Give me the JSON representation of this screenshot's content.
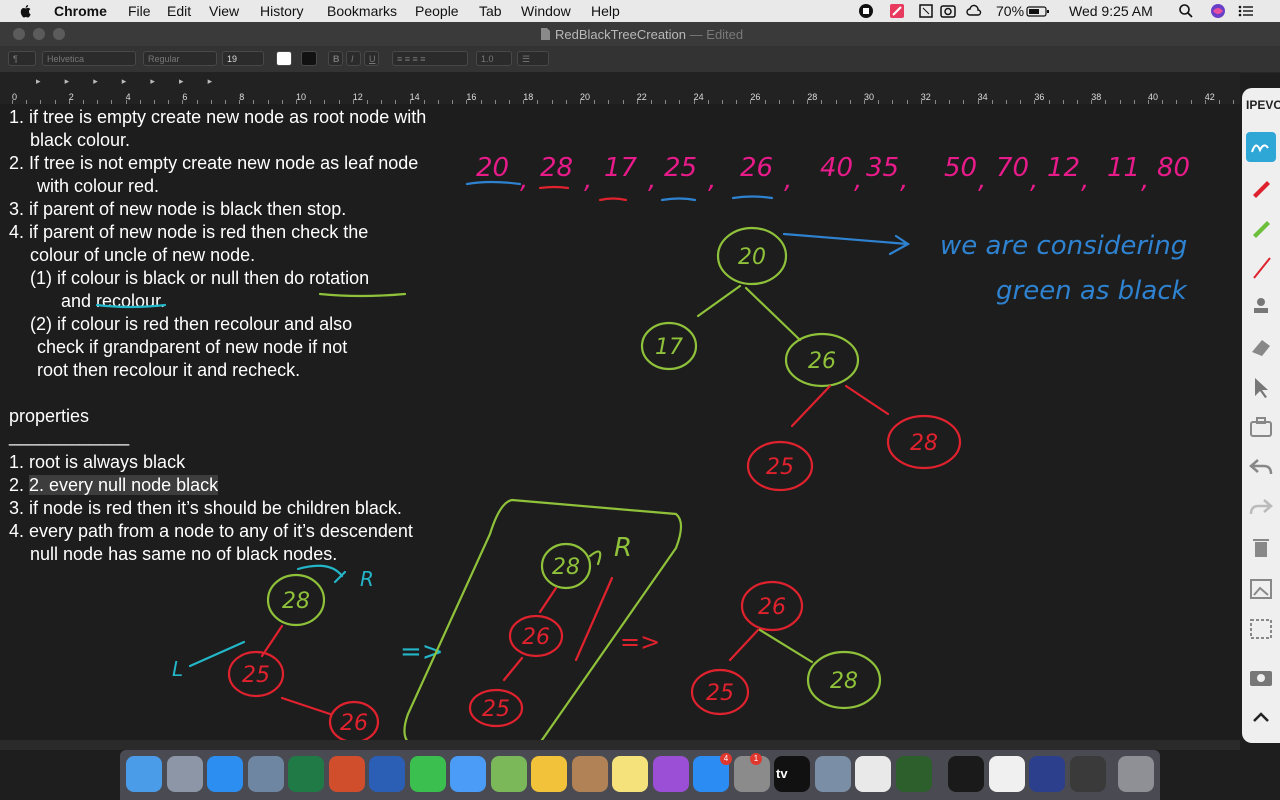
{
  "menubar": {
    "app": "Chrome",
    "items": [
      "File",
      "Edit",
      "View",
      "History",
      "Bookmarks",
      "People",
      "Tab",
      "Window",
      "Help"
    ],
    "battery": "70%",
    "clock": "Wed 9:25 AM"
  },
  "window": {
    "title": "RedBlackTreeCreation",
    "status": "— Edited"
  },
  "toolbar": {
    "font_family": "Helvetica",
    "font_style": "Regular",
    "font_size": "19",
    "bold": "B",
    "italic": "I",
    "underline": "U",
    "line_spacing": "1.0"
  },
  "ruler": {
    "ticks": [
      "0",
      "2",
      "4",
      "6",
      "8",
      "10",
      "12",
      "14",
      "16",
      "18",
      "20",
      "22",
      "24",
      "26",
      "28",
      "30",
      "32",
      "34",
      "36",
      "38",
      "40",
      "42"
    ]
  },
  "document": {
    "rules": [
      "1. if tree is empty create new node as root node with",
      "black colour.",
      "2. If tree is not empty create new node as leaf node",
      "with colour red.",
      "3. if parent of new node is black then stop.",
      "4. if parent of new node is red then check the",
      "colour of uncle of new node.",
      "(1) if colour is black or null then do rotation",
      "and recolour.",
      "(2) if colour is red then recolour and also",
      "check if grandparent of new node if not",
      "root then recolour it and recheck."
    ],
    "properties_heading": "properties",
    "properties_divider": "____________",
    "properties": [
      "1. root is always black",
      "2. every null node black",
      "3. if node is red then it’s should be children black.",
      "4. every path from a node to any of it’s descendent",
      "null node has same no of black nodes."
    ]
  },
  "handwriting": {
    "sequence": [
      "20",
      "28",
      "17",
      "25",
      "26",
      "40",
      "35",
      "50",
      "70",
      "12",
      "11",
      "80"
    ],
    "note": [
      "we are considering",
      "green as black"
    ],
    "tree_main": [
      "20",
      "17",
      "26",
      "25",
      "28"
    ],
    "tree_before_rotation": [
      "28",
      "25",
      "26"
    ],
    "rotation_label_left": "R",
    "rotation_label_left_arrow": "L",
    "tree_box": [
      "28",
      "26",
      "25"
    ],
    "tree_box_label": "R",
    "arrow_1": "=>",
    "arrow_2": "=>",
    "tree_result": [
      "26",
      "25",
      "28"
    ]
  },
  "palette": {
    "label": "IPEVO"
  },
  "colors": {
    "ink_green": "#8fc23a",
    "ink_red": "#e0222e",
    "ink_blue": "#2e82d0",
    "ink_magenta": "#e81b8a",
    "ink_cyan": "#23b6c8"
  },
  "dock": {
    "apps": [
      "finder-icon",
      "launchpad-icon",
      "safari-icon",
      "preview-icon",
      "excel-icon",
      "powerpoint-icon",
      "word-icon",
      "facetime-icon",
      "messages-icon",
      "maps-icon",
      "photos-icon",
      "contacts-icon",
      "notes-icon",
      "podcasts-icon",
      "appstore-icon",
      "system-preferences-icon",
      "tv-icon",
      "image-capture-icon",
      "chrome-icon",
      "activity-icon",
      "terminal-icon",
      "textedit-icon",
      "quicktime-icon",
      "screenshot-icon",
      "trash-icon"
    ],
    "badge_appstore": "4",
    "badge_prefs": "1",
    "tv_label": "tv"
  }
}
